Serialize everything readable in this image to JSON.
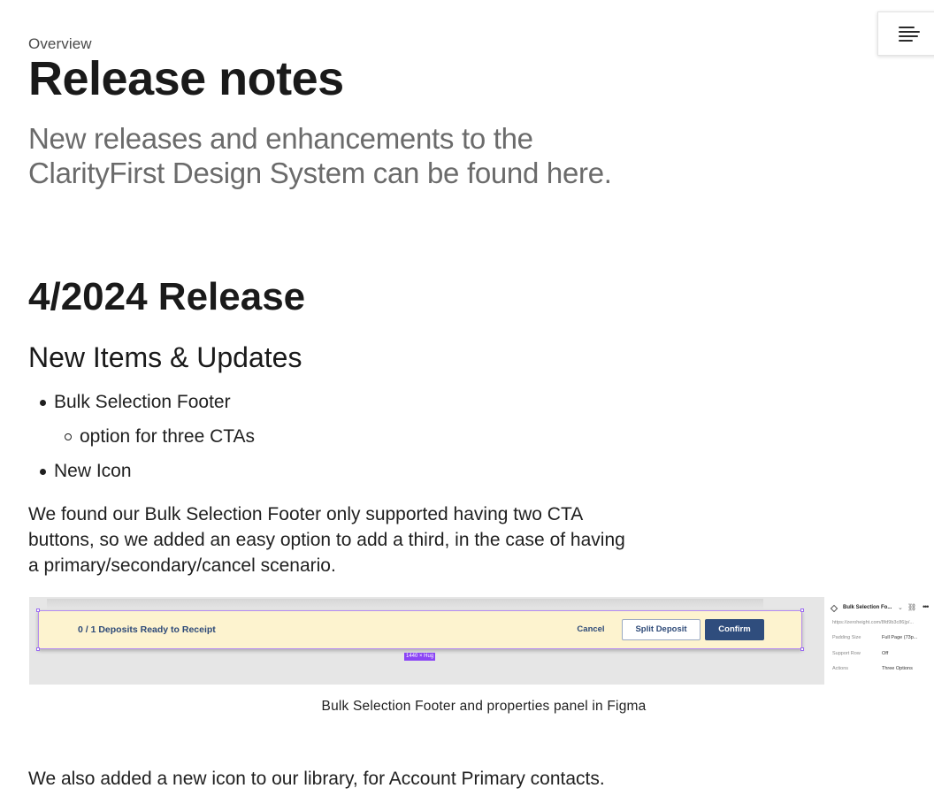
{
  "header": {
    "eyebrow": "Overview",
    "title": "Release notes",
    "intro": "New releases and enhancements to the ClarityFirst Design System can be found here."
  },
  "toc": {
    "icon": "table-of-contents-icon"
  },
  "release": {
    "title": "4/2024 Release",
    "section_title": "New Items & Updates",
    "bullets": {
      "item1": "Bulk Selection Footer",
      "item1_sub1": "option for three CTAs",
      "item2": "New Icon"
    },
    "paragraph": "We found our Bulk Selection Footer only supported having two CTA buttons, so we added an easy option to add a third, in the case of having a primary/secondary/cancel scenario."
  },
  "figure": {
    "footer": {
      "deposits_text": "0 / 1 Deposits Ready to Receipt",
      "cancel_label": "Cancel",
      "split_label": "Split Deposit",
      "confirm_label": "Confirm",
      "size_tag": "1440 × Hug"
    },
    "properties": {
      "component_name": "Bulk Selection Fo...",
      "url": "https://zeroheight.com/8fd9b3c86|p/...",
      "rows": {
        "padding_label": "Padding Size",
        "padding_value": "Full Page (73p...",
        "support_label": "Support Row",
        "support_value": "Off",
        "actions_label": "Actions",
        "actions_value": "Three Options"
      }
    },
    "caption": "Bulk Selection Footer and properties panel in Figma"
  },
  "paragraph2": "We also added a new icon to our library, for Account Primary contacts.",
  "colors": {
    "footer_bg": "#fdf3cf",
    "primary_button": "#2f4d7d",
    "selection_purple": "#8b45f5"
  }
}
